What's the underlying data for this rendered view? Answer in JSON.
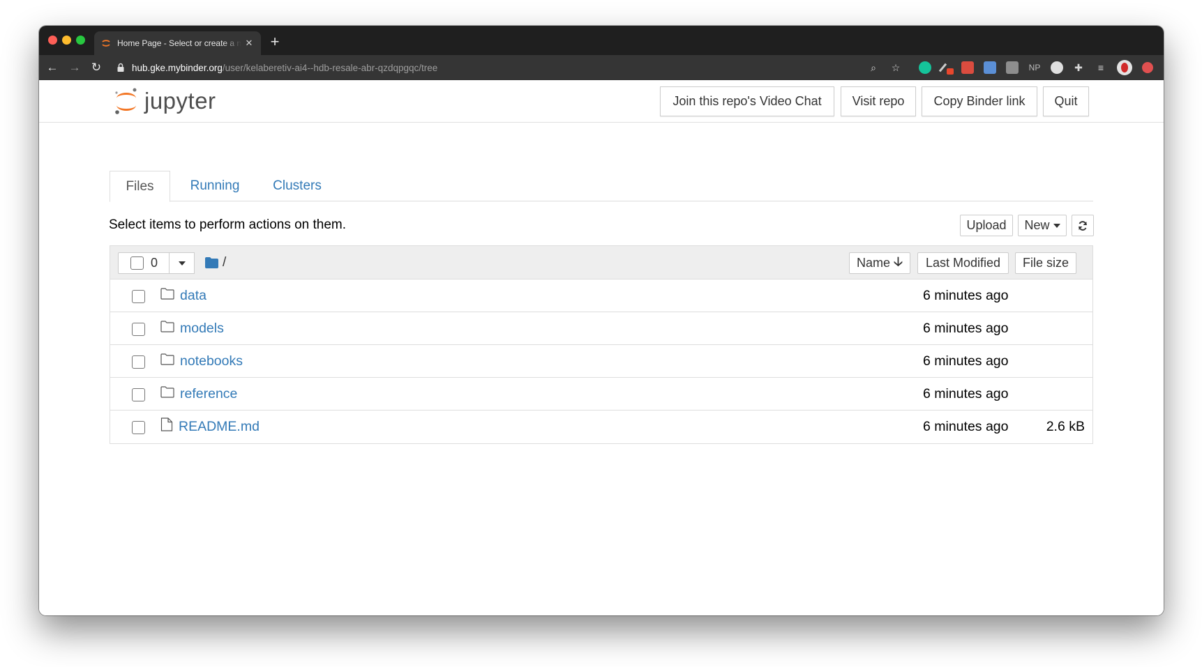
{
  "browser": {
    "tab_title": "Home Page - Select or create a notebook",
    "url_host": "hub.gke.mybinder.org",
    "url_path": "/user/kelaberetiv-ai4--hdb-resale-abr-qzdqpgqc/tree",
    "extensions": [
      "zoom-icon",
      "star-icon",
      "grammarly-icon",
      "pen-extension-icon",
      "todoist-icon",
      "calendar-extension-icon",
      "monitor-extension-icon",
      "np-extension-icon",
      "owl-extension-icon",
      "puzzle-icon",
      "reading-list-icon",
      "profile-avatar",
      "update-icon"
    ],
    "ext_np_label": "NP"
  },
  "header": {
    "logo_text": "jupyter",
    "buttons": {
      "video_chat": "Join this repo's Video Chat",
      "visit_repo": "Visit repo",
      "copy_link": "Copy Binder link",
      "quit": "Quit"
    }
  },
  "tabs": [
    {
      "label": "Files",
      "active": true
    },
    {
      "label": "Running",
      "active": false
    },
    {
      "label": "Clusters",
      "active": false
    }
  ],
  "instructions": "Select items to perform actions on them.",
  "actions": {
    "upload": "Upload",
    "new": "New"
  },
  "list_header": {
    "selected_count": "0",
    "breadcrumb": "/",
    "sort_name": "Name",
    "sort_modified": "Last Modified",
    "sort_size": "File size"
  },
  "files": [
    {
      "name": "data",
      "type": "folder",
      "modified": "6 minutes ago",
      "size": ""
    },
    {
      "name": "models",
      "type": "folder",
      "modified": "6 minutes ago",
      "size": ""
    },
    {
      "name": "notebooks",
      "type": "folder",
      "modified": "6 minutes ago",
      "size": ""
    },
    {
      "name": "reference",
      "type": "folder",
      "modified": "6 minutes ago",
      "size": ""
    },
    {
      "name": "README.md",
      "type": "file",
      "modified": "6 minutes ago",
      "size": "2.6 kB"
    }
  ],
  "colors": {
    "link": "#337ab7",
    "jupyter_orange": "#f37726",
    "chrome_dark": "#1f1f1f"
  }
}
